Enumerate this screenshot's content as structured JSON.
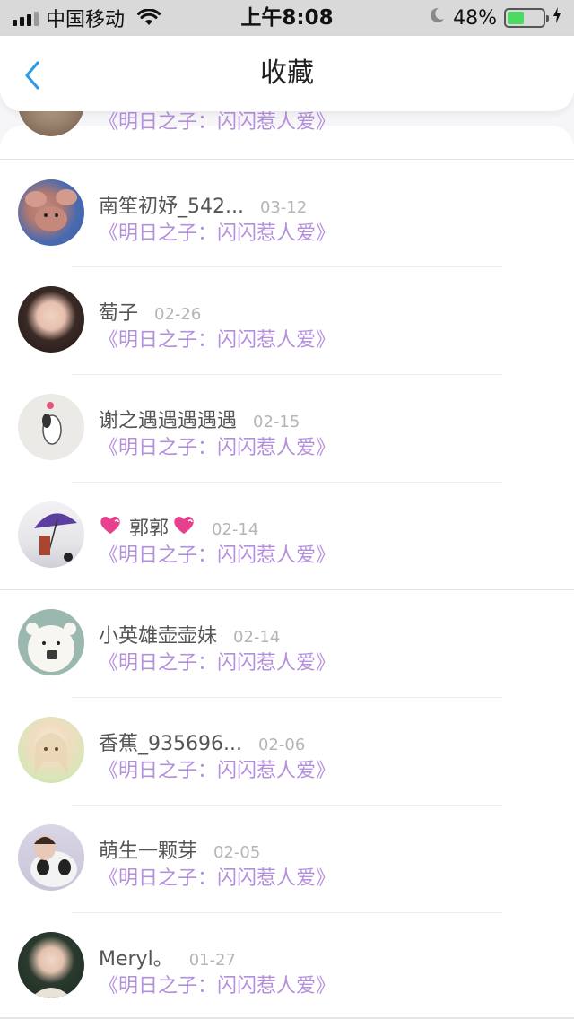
{
  "status_bar": {
    "carrier": "中国移动",
    "time": "上午8:08",
    "battery_percent": "48%",
    "battery_level": 0.48,
    "battery_color": "#4cd964"
  },
  "nav": {
    "title": "收藏",
    "back_icon": "chevron-left-icon",
    "accent": "#2d9ce8"
  },
  "partial_item": {
    "collection": "《明日之子：闪闪惹人爱》"
  },
  "items": [
    {
      "name": "南笙初妤_542...",
      "date": "03-12",
      "collection": "《明日之子：闪闪惹人爱》",
      "avatar": "cartoon-bear-avatar"
    },
    {
      "name": "萄子",
      "date": "02-26",
      "collection": "《明日之子：闪闪惹人爱》",
      "avatar": "girl-portrait-avatar"
    },
    {
      "name": "谢之遇遇遇遇遇",
      "date": "02-15",
      "collection": "《明日之子：闪闪惹人爱》",
      "avatar": "snoopy-avatar"
    },
    {
      "name": "郭郭",
      "date": "02-14",
      "collection": "《明日之子：闪闪惹人爱》",
      "avatar": "umbrella-girl-avatar",
      "decorated": true
    },
    {
      "name": "小英雄壶壶妹",
      "date": "02-14",
      "collection": "《明日之子：闪闪惹人爱》",
      "avatar": "white-bear-avatar"
    },
    {
      "name": "香蕉_935696...",
      "date": "02-06",
      "collection": "《明日之子：闪闪惹人爱》",
      "avatar": "anime-girl-avatar"
    },
    {
      "name": "萌生一颗芽",
      "date": "02-05",
      "collection": "《明日之子：闪闪惹人爱》",
      "avatar": "panda-avatar"
    },
    {
      "name": "Meryl。",
      "date": "01-27",
      "collection": "《明日之子：闪闪惹人爱》",
      "avatar": "woman-portrait-avatar"
    }
  ],
  "colors": {
    "collection_text": "#b48fdc",
    "name_text": "#555555",
    "date_text": "#b5b5b5"
  }
}
